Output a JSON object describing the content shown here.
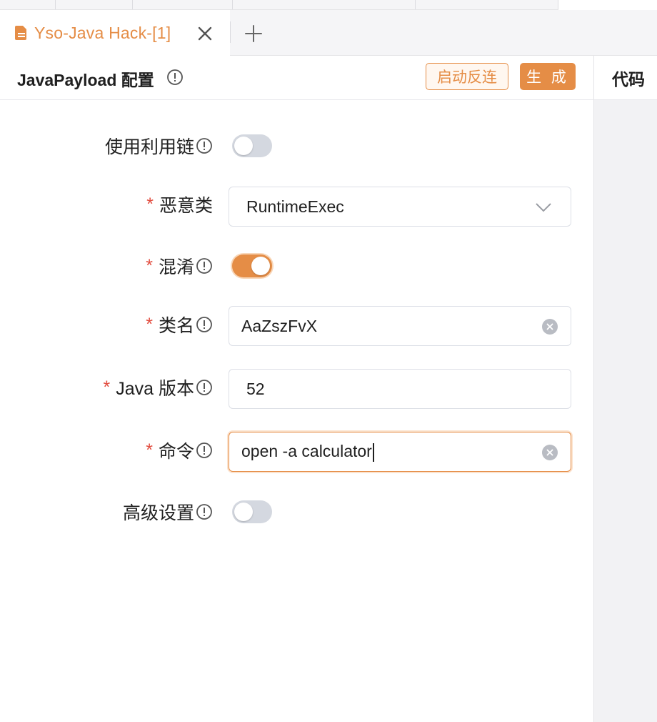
{
  "tabs": {
    "active_label": "Yso-Java Hack-[1]",
    "add_label": "+"
  },
  "header": {
    "title": "JavaPayload 配置",
    "reverse_button": "启动反连",
    "generate_button": "生 成"
  },
  "right_panel": {
    "title": "代码"
  },
  "form": {
    "use_chain": {
      "label": "使用利用链",
      "enabled": false
    },
    "malicious_class": {
      "label": "恶意类",
      "required": "*",
      "value": "RuntimeExec",
      "icon": "chevron-down-icon"
    },
    "obfuscate": {
      "label": "混淆",
      "required": "*",
      "enabled": true
    },
    "class_name": {
      "label": "类名",
      "required": "*",
      "value": "AaZszFvX"
    },
    "java_version": {
      "label": "Java 版本",
      "required": "*",
      "value": "52"
    },
    "command": {
      "label": "命令",
      "required": "*",
      "value": "open -a calculator"
    },
    "advanced": {
      "label": "高级设置",
      "enabled": false
    }
  },
  "colors": {
    "accent": "#e58d46",
    "required": "#e24c3f",
    "toggle_off": "#d4d8e0"
  }
}
